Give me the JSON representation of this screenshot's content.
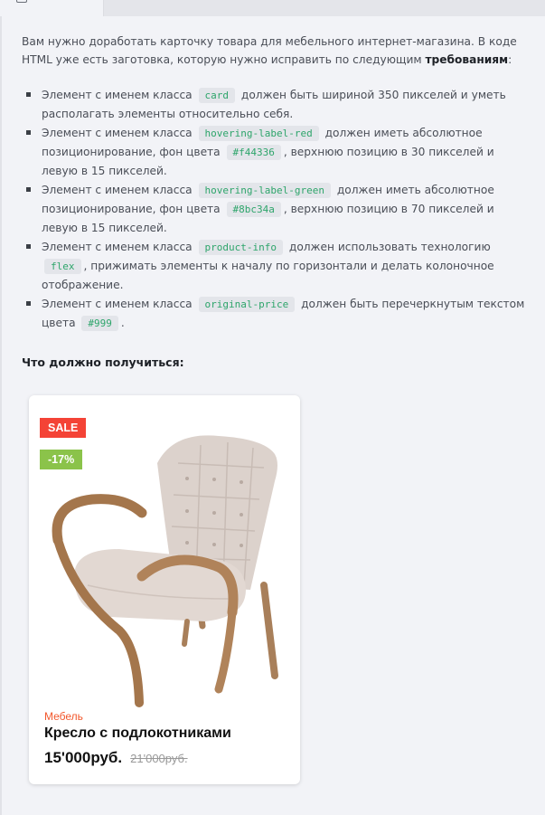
{
  "intro": {
    "text_before": "Вам нужно доработать карточку товара для мебельного интернет-магазина. В коде HTML уже есть заготовка, которую нужно исправить по следующим ",
    "bold": "требованиям",
    "text_after": ":"
  },
  "requirements": [
    {
      "a": "Элемент с именем класса ",
      "code1": "card",
      "b": " должен быть шириной 350 пикселей и уметь располагать элементы относительно себя."
    },
    {
      "a": "Элемент с именем класса ",
      "code1": "hovering-label-red",
      "b": " должен иметь абсолютное позиционирование, фон цвета ",
      "code2": "#f44336",
      "c": ", верхнюю позицию в 30 пикселей и левую в 15 пикселей."
    },
    {
      "a": "Элемент с именем класса ",
      "code1": "hovering-label-green",
      "b": " должен иметь абсолютное позиционирование, фон цвета ",
      "code2": "#8bc34a",
      "c": ", верхнюю позицию в 70 пикселей и левую в 15 пикселей."
    },
    {
      "a": "Элемент с именем класса ",
      "code1": "product-info",
      "b": " должен использовать технологию ",
      "code2": "flex",
      "c": ", прижимать элементы к началу по горизонтали и делать колоночное отображение."
    },
    {
      "a": "Элемент с именем класса ",
      "code1": "original-price",
      "b": " должен быть перечеркнутым текстом цвета ",
      "code2": "#999",
      "c": "."
    }
  ],
  "result_title": "Что должно получиться:",
  "card": {
    "label_red": "SALE",
    "label_green": "-17%",
    "category": "Мебель",
    "name": "Кресло с подлокотниками",
    "price": "15'000руб.",
    "original_price": "21'000руб."
  },
  "colors": {
    "red": "#f44336",
    "green": "#8bc34a",
    "code_text": "#2ea56b",
    "original_price": "#999",
    "category": "#f2572b"
  }
}
